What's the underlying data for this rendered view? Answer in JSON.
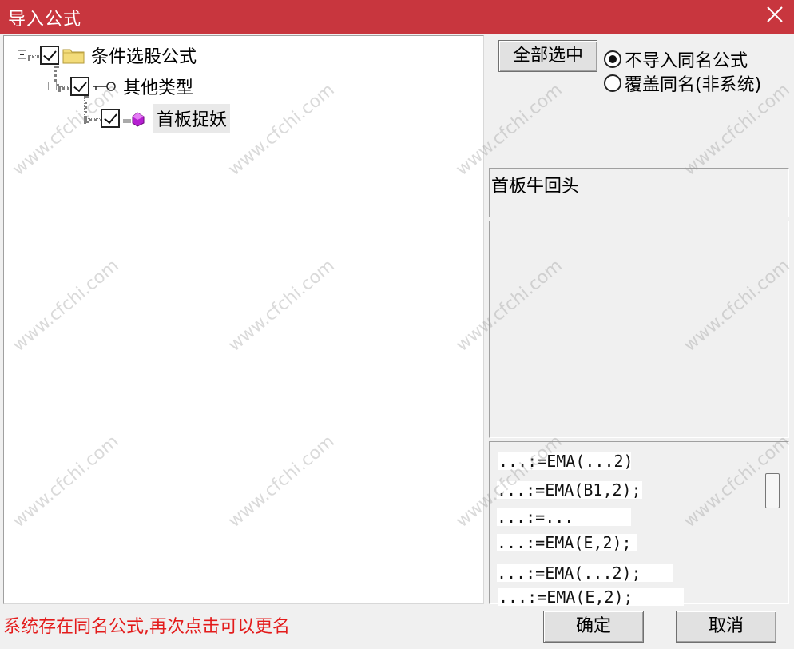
{
  "window": {
    "title": "导入公式",
    "title_bar_color": "#c8363e"
  },
  "tree": {
    "root": {
      "label": "条件选股公式",
      "checked": true,
      "icon": "folder-icon"
    },
    "category": {
      "label": "其他类型",
      "checked": true,
      "icon": "key-icon"
    },
    "formula": {
      "label": "首板捉妖",
      "checked": true,
      "icon": "formula-gem-icon"
    }
  },
  "options": {
    "select_all_label": "全部选中",
    "radio_no_import": "不导入同名公式",
    "radio_overwrite": "覆盖同名(非系统)",
    "selected_option": "不导入同名公式"
  },
  "formula_name": "首板牛回头",
  "code_lines": [
    "...:=EMA(...2)",
    "...:=EMA(B1,2);",
    "...:=...",
    "...:=EMA(E,2);",
    "...:=EMA(...2);",
    "...:=EMA(E,2);"
  ],
  "status_text": "系统存在同名公式,再次点击可以更名",
  "status_color": "#e31b1b",
  "buttons": {
    "ok": "确定",
    "cancel": "取消"
  },
  "watermark_text": "www.cfchi.com"
}
